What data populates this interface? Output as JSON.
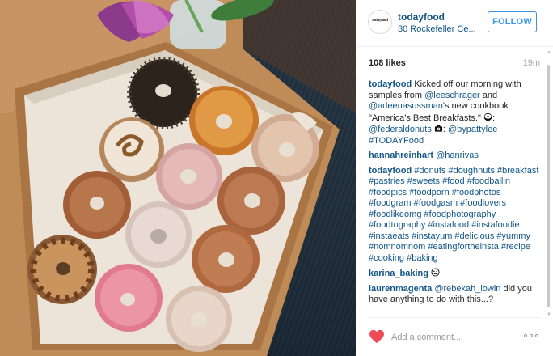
{
  "post": {
    "username": "todayfood",
    "location": "30 Rockefeller Ce...",
    "avatar_text": "todayfood",
    "follow_label": "FOLLOW",
    "likes": "108 likes",
    "time_ago": "19m"
  },
  "comments": [
    {
      "user": "todayfood",
      "parts": [
        {
          "t": "text",
          "v": " Kicked off our morning with samples from "
        },
        {
          "t": "link",
          "v": "@leeschrager"
        },
        {
          "t": "text",
          "v": " and "
        },
        {
          "t": "link",
          "v": "@adeenasussman"
        },
        {
          "t": "text",
          "v": "'s new cookbook \"America's Best Breakfasts.\" "
        },
        {
          "t": "emoji",
          "v": "donut-emoji"
        },
        {
          "t": "text",
          "v": ": "
        },
        {
          "t": "link",
          "v": "@federaldonuts"
        },
        {
          "t": "text",
          "v": " "
        },
        {
          "t": "emoji",
          "v": "camera-emoji"
        },
        {
          "t": "text",
          "v": ": "
        },
        {
          "t": "link",
          "v": "@bypattylee"
        },
        {
          "t": "text",
          "v": " "
        },
        {
          "t": "link",
          "v": "#TODAYFood"
        }
      ]
    },
    {
      "user": "hannahreinhart",
      "parts": [
        {
          "t": "text",
          "v": " "
        },
        {
          "t": "link",
          "v": "@hanrivas"
        }
      ]
    },
    {
      "user": "todayfood",
      "parts": [
        {
          "t": "text",
          "v": " "
        },
        {
          "t": "link",
          "v": "#donuts"
        },
        {
          "t": "text",
          "v": " "
        },
        {
          "t": "link",
          "v": "#doughnuts"
        },
        {
          "t": "text",
          "v": " "
        },
        {
          "t": "link",
          "v": "#breakfast"
        },
        {
          "t": "text",
          "v": " "
        },
        {
          "t": "link",
          "v": "#pastries"
        },
        {
          "t": "text",
          "v": " "
        },
        {
          "t": "link",
          "v": "#sweets"
        },
        {
          "t": "text",
          "v": " "
        },
        {
          "t": "link",
          "v": "#food"
        },
        {
          "t": "text",
          "v": " "
        },
        {
          "t": "link",
          "v": "#foodballin"
        },
        {
          "t": "text",
          "v": " "
        },
        {
          "t": "link",
          "v": "#foodpics"
        },
        {
          "t": "text",
          "v": " "
        },
        {
          "t": "link",
          "v": "#foodporn"
        },
        {
          "t": "text",
          "v": " "
        },
        {
          "t": "link",
          "v": "#foodphotos"
        },
        {
          "t": "text",
          "v": " "
        },
        {
          "t": "link",
          "v": "#foodgram"
        },
        {
          "t": "text",
          "v": " "
        },
        {
          "t": "link",
          "v": "#foodgasm"
        },
        {
          "t": "text",
          "v": " "
        },
        {
          "t": "link",
          "v": "#foodlovers"
        },
        {
          "t": "text",
          "v": " "
        },
        {
          "t": "link",
          "v": "#foodlikeomg"
        },
        {
          "t": "text",
          "v": " "
        },
        {
          "t": "link",
          "v": "#foodphotography"
        },
        {
          "t": "text",
          "v": " "
        },
        {
          "t": "link",
          "v": "#foodtography"
        },
        {
          "t": "text",
          "v": " "
        },
        {
          "t": "link",
          "v": "#instafood"
        },
        {
          "t": "text",
          "v": " "
        },
        {
          "t": "link",
          "v": "#instafoodie"
        },
        {
          "t": "text",
          "v": " "
        },
        {
          "t": "link",
          "v": "#instaeats"
        },
        {
          "t": "text",
          "v": " "
        },
        {
          "t": "link",
          "v": "#instayum"
        },
        {
          "t": "text",
          "v": " "
        },
        {
          "t": "link",
          "v": "#delicious"
        },
        {
          "t": "text",
          "v": " "
        },
        {
          "t": "link",
          "v": "#yummy"
        },
        {
          "t": "text",
          "v": " "
        },
        {
          "t": "link",
          "v": "#nomnomnom"
        },
        {
          "t": "text",
          "v": " "
        },
        {
          "t": "link",
          "v": "#eatingfortheinsta"
        },
        {
          "t": "text",
          "v": " "
        },
        {
          "t": "link",
          "v": "#recipe"
        },
        {
          "t": "text",
          "v": " "
        },
        {
          "t": "link",
          "v": "#cooking"
        },
        {
          "t": "text",
          "v": " "
        },
        {
          "t": "link",
          "v": "#baking"
        }
      ]
    },
    {
      "user": "karina_baking",
      "parts": [
        {
          "t": "text",
          "v": " "
        },
        {
          "t": "emoji",
          "v": "smiley-emoji"
        }
      ]
    },
    {
      "user": "laurenmagenta",
      "parts": [
        {
          "t": "text",
          "v": " "
        },
        {
          "t": "link",
          "v": "@rebekah_lowin"
        },
        {
          "t": "text",
          "v": " did you have anything to do with this...?"
        }
      ]
    }
  ],
  "footer": {
    "comment_placeholder": "Add a comment...",
    "heart_icon": "heart-icon",
    "more_icon": "more-options-icon"
  },
  "colors": {
    "link": "#125688",
    "follow": "#3897f0",
    "heart": "#ed4956",
    "muted": "#a5a7aa"
  },
  "photo": {
    "subject": "donut-box-photo"
  }
}
